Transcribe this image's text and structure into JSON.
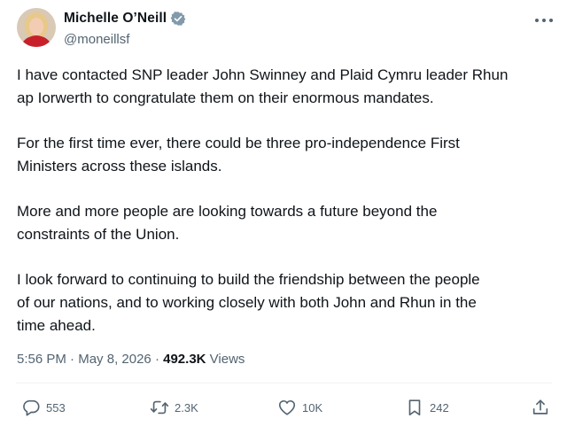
{
  "author": {
    "name": "Michelle O’Neill",
    "handle": "@moneillsf"
  },
  "tweet": {
    "paragraphs": [
      "I have contacted SNP leader John Swinney and Plaid Cymru leader Rhun\nap Iorwerth to congratulate them on their enormous mandates.",
      "For the first time ever, there could be three pro-independence First\nMinisters across these islands.",
      "More and more people are looking towards a future beyond the\nconstraints of the Union.",
      "I look forward to continuing to build the friendship between the people\nof our nations, and to working closely with both John and Rhun in the\ntime ahead."
    ],
    "time": "5:56 PM",
    "date": "May 8, 2026",
    "views_count": "492.3K",
    "views_label": "Views"
  },
  "actions": {
    "replies": "553",
    "reposts": "2.3K",
    "likes": "10K",
    "bookmarks": "242"
  },
  "colors": {
    "text": "#0f1419",
    "secondary": "#536471",
    "verified": "#829aab"
  },
  "icons": [
    "verified-badge-icon",
    "more-icon",
    "reply-icon",
    "repost-icon",
    "like-icon",
    "bookmark-icon",
    "share-icon"
  ]
}
